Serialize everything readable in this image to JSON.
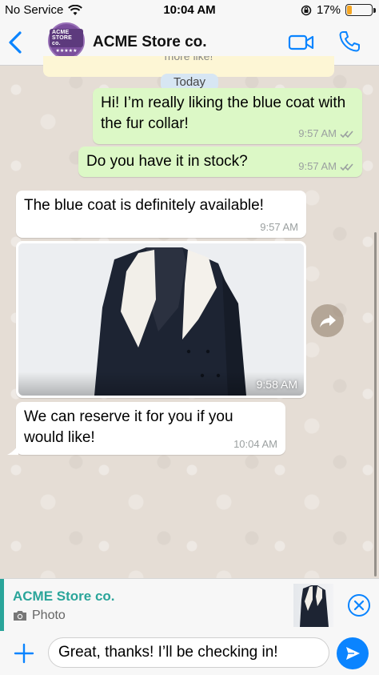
{
  "status_bar": {
    "carrier": "No Service",
    "time": "10:04 AM",
    "battery": "17%",
    "battery_level": 0.17
  },
  "header": {
    "contact_name": "ACME Store co.",
    "avatar_text": "ACME STORE co.",
    "avatar_stars": "★★★★★"
  },
  "chat": {
    "partial_text": "more like!",
    "date_label": "Today",
    "messages": [
      {
        "direction": "out",
        "text": "Hi! I’m really liking the blue coat with the fur collar!",
        "time": "9:57 AM"
      },
      {
        "direction": "out",
        "text": "Do you have it in stock?",
        "time": "9:57 AM"
      },
      {
        "direction": "in",
        "text": "The blue coat is definitely available!",
        "time": "9:57 AM"
      },
      {
        "direction": "in",
        "type": "photo",
        "time": "9:58 AM"
      },
      {
        "direction": "in",
        "text": "We can reserve it for you if you would like!",
        "time": "10:04 AM"
      }
    ]
  },
  "reply_preview": {
    "sender": "ACME Store co.",
    "type_label": "Photo"
  },
  "composer": {
    "value": "Great, thanks! I’ll be checking in!"
  },
  "colors": {
    "accent": "#0a84ff",
    "outgoing_bubble": "#dcf8c6",
    "incoming_bubble": "#ffffff",
    "reply_accent": "#2aa59a"
  }
}
